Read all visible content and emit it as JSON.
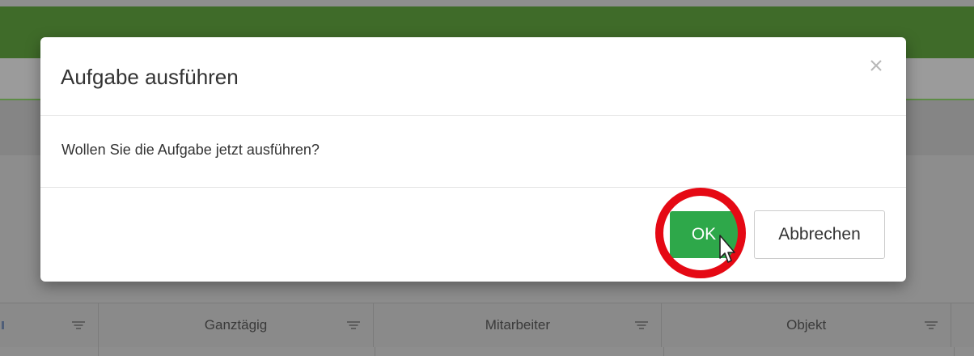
{
  "dialog": {
    "title": "Aufgabe ausführen",
    "message": "Wollen Sie die Aufgabe jetzt ausführen?",
    "ok_label": "OK",
    "cancel_label": "Abbrechen",
    "close_glyph": "×"
  },
  "grid": {
    "columns": [
      {
        "label": ""
      },
      {
        "label": "Ganztägig"
      },
      {
        "label": "Mitarbeiter"
      },
      {
        "label": "Objekt"
      },
      {
        "label": ""
      }
    ]
  },
  "colors": {
    "header_green": "#3f6b29",
    "ok_green": "#2ea84a",
    "highlight_red": "#e50914"
  },
  "icons": {
    "close": "close-icon",
    "filter": "filter-icon",
    "cursor": "mouse-pointer-icon"
  }
}
